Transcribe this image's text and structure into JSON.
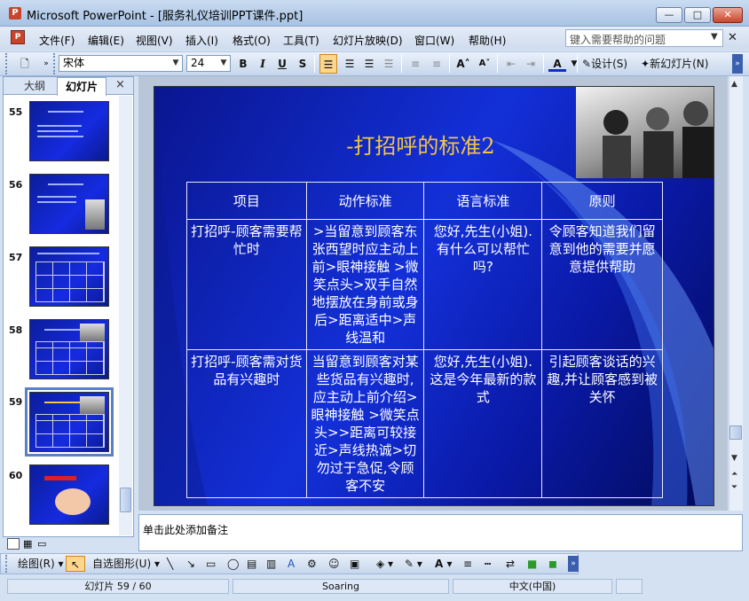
{
  "window": {
    "title": "Microsoft PowerPoint - [服务礼仪培训PPT课件.ppt]",
    "app_icon": "P",
    "min": "—",
    "max": "□",
    "close": "✕"
  },
  "menu": {
    "items": [
      "文件(F)",
      "编辑(E)",
      "视图(V)",
      "插入(I)",
      "格式(O)",
      "工具(T)",
      "幻灯片放映(D)",
      "窗口(W)",
      "帮助(H)"
    ],
    "help_placeholder": "键入需要帮助的问题",
    "close": "✕"
  },
  "toolbar": {
    "font": "宋体",
    "size": "24",
    "bold": "B",
    "italic": "I",
    "underline": "U",
    "shadow": "S",
    "design": "设计(S)",
    "new_slide": "新幻灯片(N)"
  },
  "panel": {
    "tab_outline": "大纲",
    "tab_slides": "幻灯片",
    "close": "×",
    "slides": [
      {
        "num": "55",
        "kind": "text"
      },
      {
        "num": "56",
        "kind": "text-photo"
      },
      {
        "num": "57",
        "kind": "table"
      },
      {
        "num": "58",
        "kind": "table-photo"
      },
      {
        "num": "59",
        "kind": "table-photo",
        "selected": true
      },
      {
        "num": "60",
        "kind": "art"
      }
    ]
  },
  "slide": {
    "title": "-打招呼的标准2",
    "headers": [
      "项目",
      "动作标准",
      "语言标准",
      "原则"
    ],
    "rows": [
      [
        "打招呼-顾客需要帮忙时",
        ">当留意到顾客东张西望时应主动上前>眼神接触 >微笑点头>双手自然地摆放在身前或身后>距离适中>声线温和",
        "您好,先生(小姐).有什么可以帮忙吗?",
        "令顾客知道我们留意到他的需要并愿意提供帮助"
      ],
      [
        "打招呼-顾客需对货品有兴趣时",
        "当留意到顾客对某些货品有兴趣时,应主动上前介绍>眼神接触 >微笑点头>>距离可较接近>声线热诚>切勿过于急促,令顾客不安",
        "您好,先生(小姐).这是今年最新的款式",
        "引起顾客谈话的兴趣,并让顾客感到被关怀"
      ]
    ]
  },
  "notes": {
    "placeholder": "单击此处添加备注"
  },
  "drawbar": {
    "draw": "绘图(R)",
    "autoshapes": "自选图形(U)"
  },
  "status": {
    "slide": "幻灯片 59 / 60",
    "design": "Soaring",
    "lang": "中文(中国)"
  },
  "colors": {
    "slide_title": "#f4c542",
    "slide_bg": "#1330d8",
    "chrome": "#d4e1f3"
  }
}
